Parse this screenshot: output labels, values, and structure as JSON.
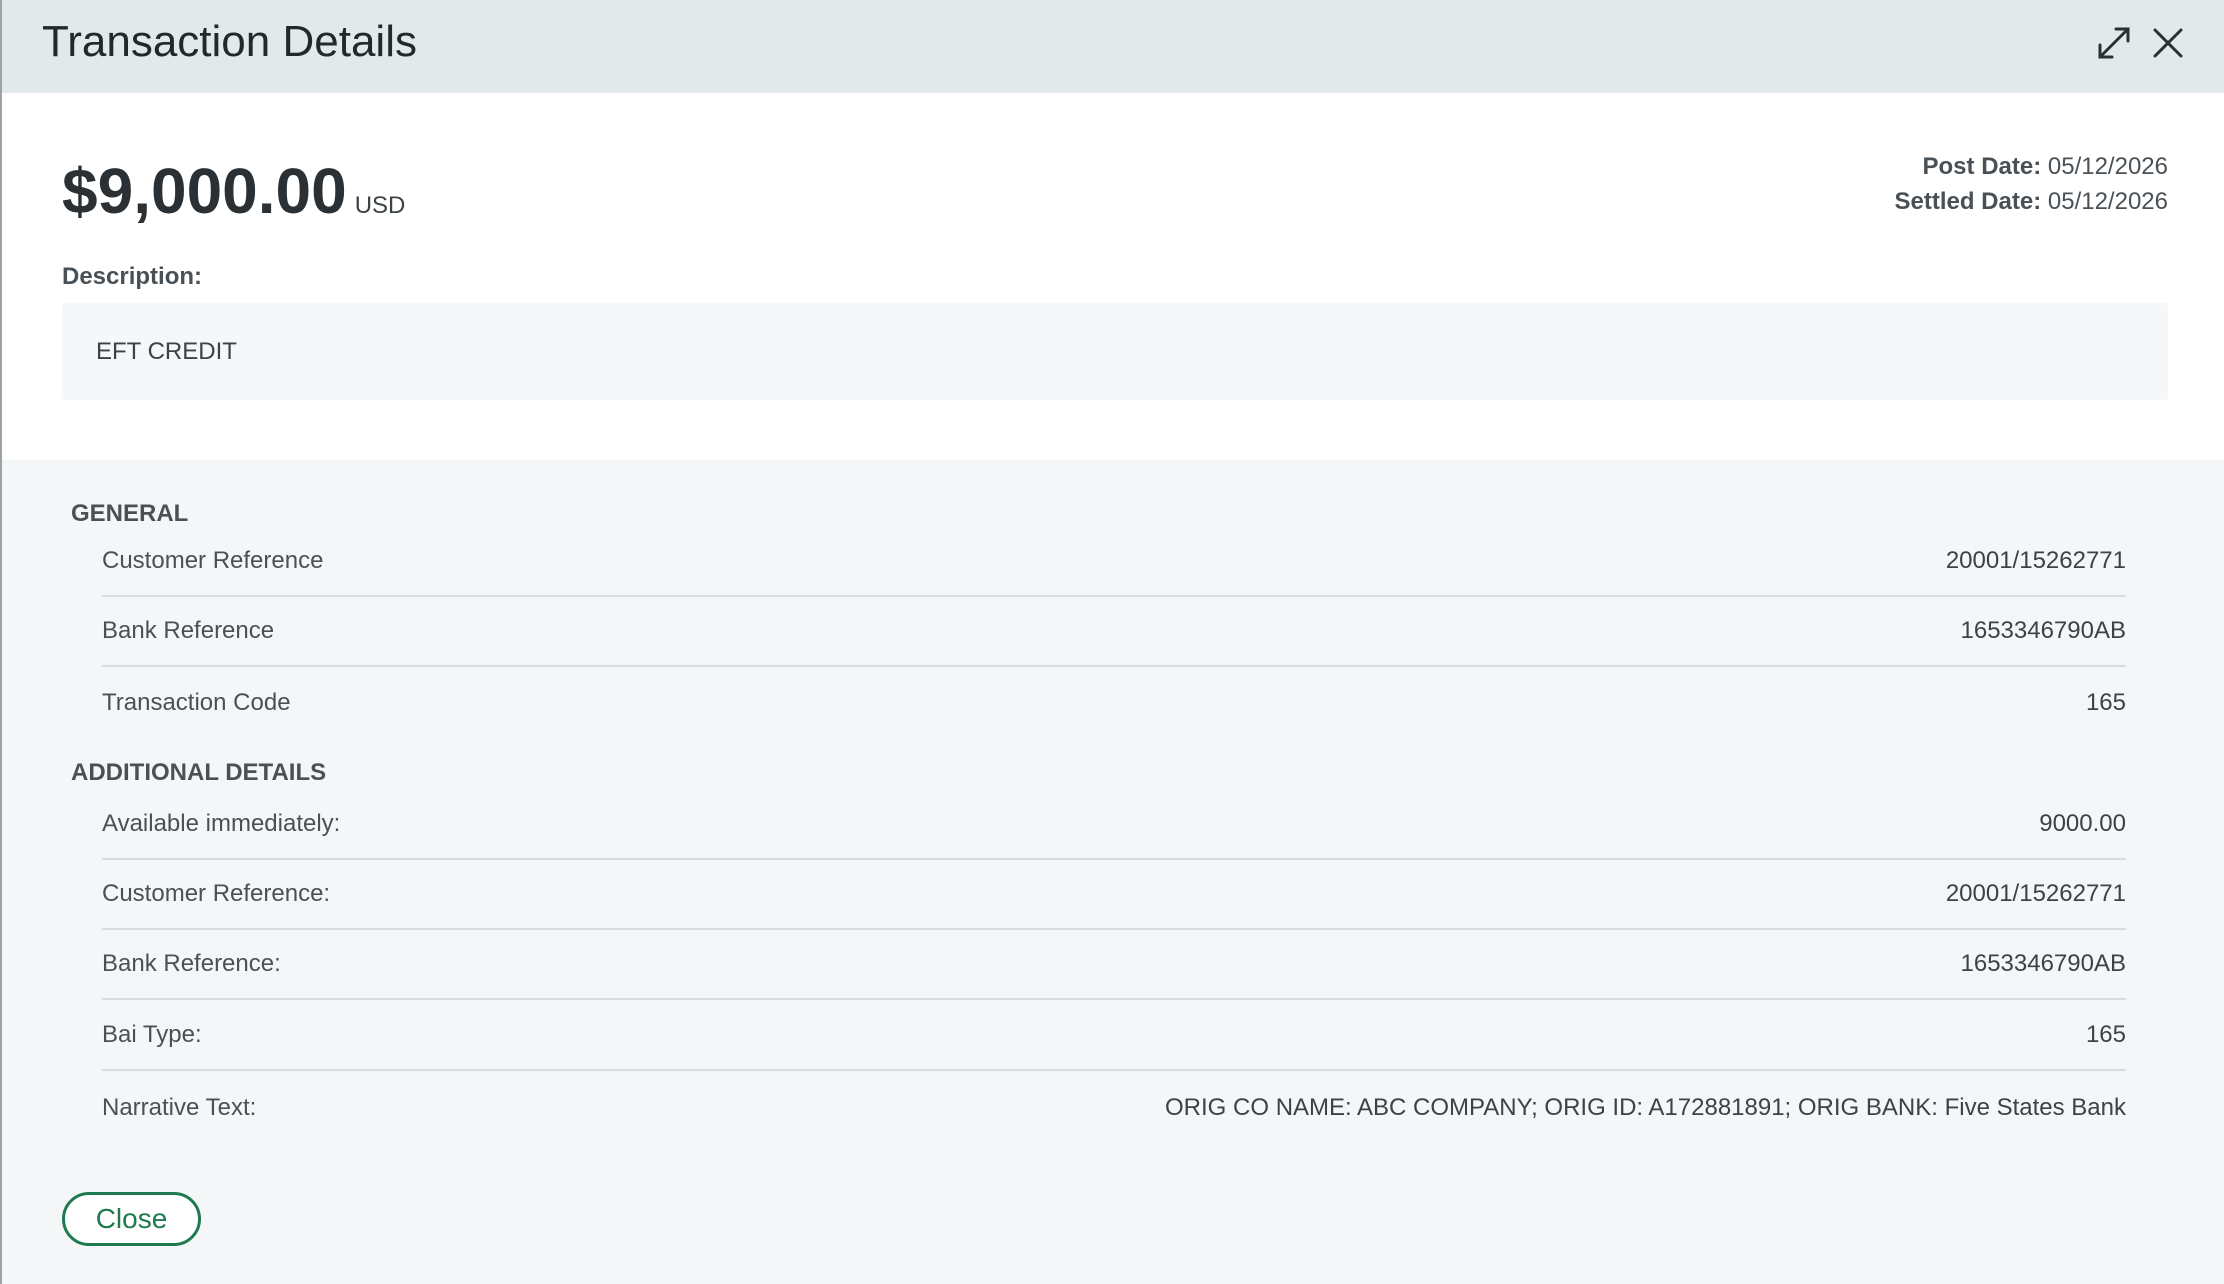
{
  "header": {
    "title": "Transaction Details",
    "expand_icon": "expand-icon",
    "close_icon": "close-icon"
  },
  "summary": {
    "amount": "$9,000.00",
    "currency": "USD",
    "post_date_label": "Post Date:",
    "post_date": "05/12/2026",
    "settled_date_label": "Settled Date:",
    "settled_date": "05/12/2026",
    "description_label": "Description:",
    "description": "EFT CREDIT"
  },
  "general": {
    "title": "GENERAL",
    "rows": [
      {
        "label": "Customer Reference",
        "value": "20001/15262771"
      },
      {
        "label": "Bank Reference",
        "value": "1653346790AB"
      },
      {
        "label": "Transaction Code",
        "value": "165"
      }
    ]
  },
  "additional": {
    "title": "ADDITIONAL DETAILS",
    "rows": [
      {
        "label": "Available immediately:",
        "value": "9000.00"
      },
      {
        "label": "Customer Reference:",
        "value": "20001/15262771"
      },
      {
        "label": "Bank Reference:",
        "value": "1653346790AB"
      },
      {
        "label": "Bai Type:",
        "value": "165"
      },
      {
        "label": "Narrative Text:",
        "value": "ORIG CO NAME: ABC COMPANY; ORIG ID: A172881891; ORIG BANK: Five States Bank"
      }
    ]
  },
  "footer": {
    "close_label": "Close"
  },
  "colors": {
    "header_bg": "#e3e9eb",
    "panel_bg": "#f5f6f8",
    "accent_green": "#1e7a4f"
  }
}
